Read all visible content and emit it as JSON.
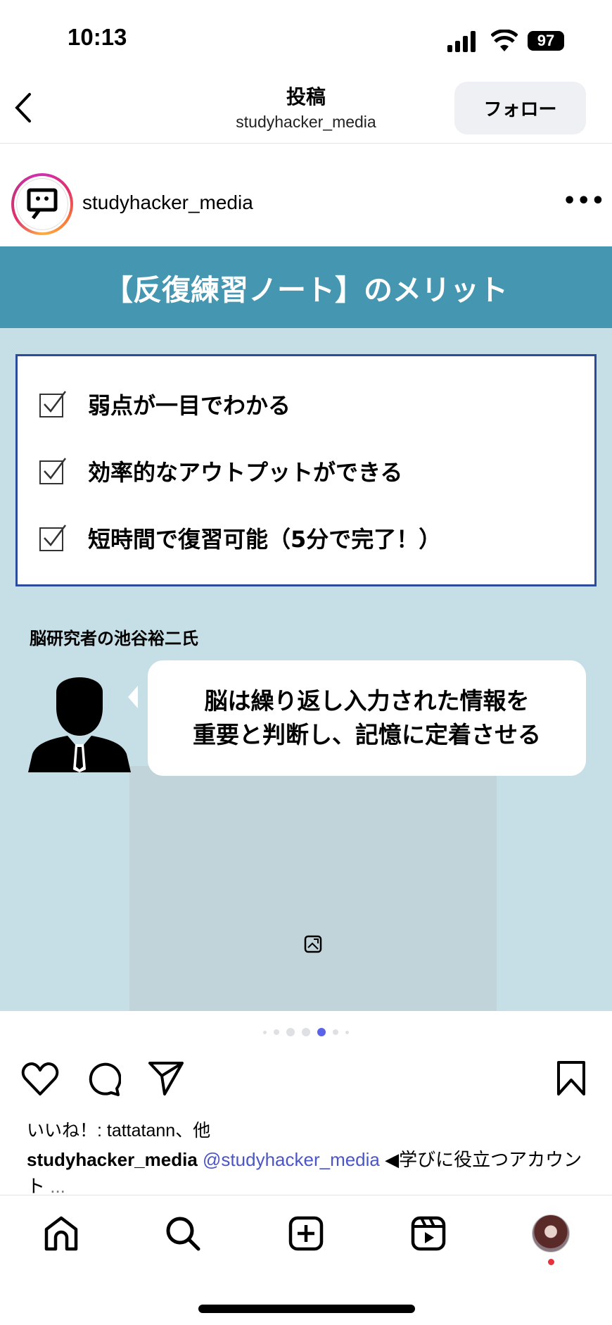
{
  "status_bar": {
    "time": "10:13",
    "battery": "97"
  },
  "nav": {
    "title": "投稿",
    "subtitle": "studyhacker_media",
    "follow_label": "フォロー"
  },
  "post_header": {
    "username": "studyhacker_media",
    "more": "•••"
  },
  "slide": {
    "title": "【反復練習ノート】のメリット",
    "checklist": [
      "弱点が一目でわかる",
      "効率的なアウトプットができる",
      "短時間で復習可能（5分で完了！）"
    ],
    "researcher_label": "脳研究者の池谷裕二氏",
    "quote_lines": [
      "脳は繰り返し入力された情報を",
      "重要と判断し、記憶に定着させる"
    ],
    "colors": {
      "banner": "#4596b0",
      "background": "#c6dfe6",
      "box_border": "#2b4c9b"
    }
  },
  "carousel": {
    "count": 7,
    "active_index": 4,
    "accent": "#5b63e8"
  },
  "likes": "いいね！: tattatann、他",
  "caption": {
    "username": "studyhacker_media",
    "mention": "@studyhacker_media",
    "text": " ◀学びに役立つアカウント",
    "more": " ..."
  },
  "tab_bar": [
    "home-icon",
    "search-icon",
    "create-icon",
    "reels-icon",
    "profile-avatar"
  ]
}
